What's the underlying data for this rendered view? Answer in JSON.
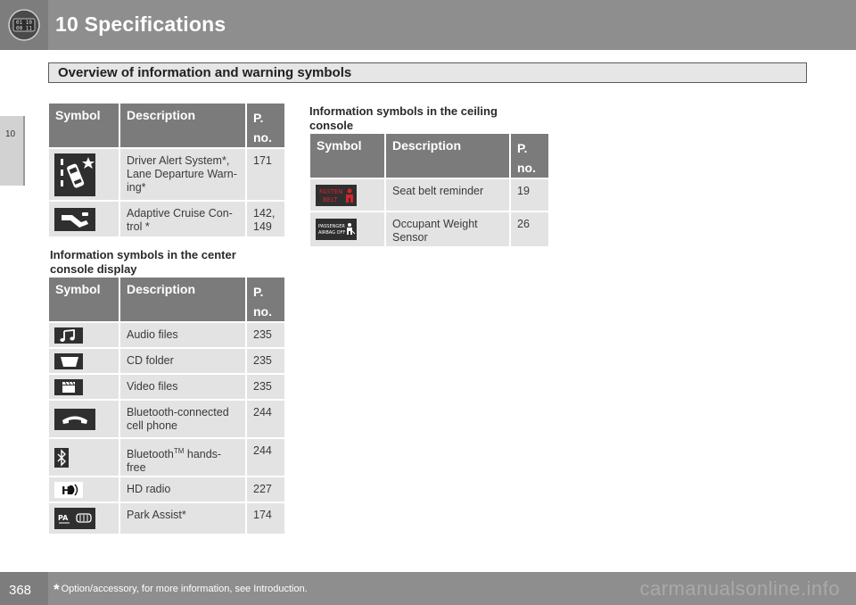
{
  "header": {
    "chapter_title": "10 Specifications",
    "icon": "car-info-display-icon"
  },
  "side_tab": {
    "label": "10"
  },
  "section": {
    "title": "Overview of information and warning symbols"
  },
  "table_top": {
    "headers": {
      "symbol": "Symbol",
      "description": "Description",
      "page_p": "P.",
      "page_no": "no."
    },
    "rows": [
      {
        "icon": "driver-alert-lane-departure-icon",
        "description": "Driver Alert System*, Lane Departure Warn-ing*",
        "page": "171"
      },
      {
        "icon": "adaptive-cruise-control-icon",
        "description": "Adaptive Cruise Con-trol *",
        "page": "142, 149"
      }
    ]
  },
  "center_console": {
    "heading": "Information symbols in the center console display",
    "headers": {
      "symbol": "Symbol",
      "description": "Description",
      "page_p": "P.",
      "page_no": "no."
    },
    "rows": [
      {
        "icon": "music-note-icon",
        "description": "Audio files",
        "page": "235"
      },
      {
        "icon": "cd-folder-icon",
        "description": "CD folder",
        "page": "235"
      },
      {
        "icon": "video-clapper-icon",
        "description": "Video files",
        "page": "235"
      },
      {
        "icon": "phone-handset-icon",
        "description": "Bluetooth-connected cell phone",
        "page": "244"
      },
      {
        "icon": "bluetooth-icon",
        "description_main": "Bluetooth",
        "description_sup": "TM",
        "description_rest": " hands-free",
        "page": "244"
      },
      {
        "icon": "hd-radio-icon",
        "description": "HD radio",
        "page": "227"
      },
      {
        "icon": "park-assist-icon",
        "description": "Park Assist*",
        "page": "174"
      }
    ]
  },
  "ceiling_console": {
    "heading": "Information symbols in the ceiling console",
    "headers": {
      "symbol": "Symbol",
      "description": "Description",
      "page_p": "P.",
      "page_no": "no."
    },
    "rows": [
      {
        "icon": "fasten-belt-icon",
        "icon_text_1": "FASTEN",
        "icon_text_2": "BELT",
        "description": "Seat belt reminder",
        "page": "19"
      },
      {
        "icon": "passenger-airbag-off-icon",
        "icon_text_1": "PASSENGER",
        "icon_text_2": "AIRBAG OFF",
        "description": "Occupant Weight Sensor",
        "page": "26"
      }
    ]
  },
  "footer": {
    "page_number": "368",
    "footnote_star": "*",
    "footnote": "Option/accessory, for more information, see Introduction.",
    "watermark": "carmanualsonline.info"
  },
  "colors": {
    "header_gray": "#8e8e8e",
    "table_header": "#7b7b7b",
    "table_cell": "#e3e3e3",
    "fasten_belt_red": "#d8232a"
  }
}
